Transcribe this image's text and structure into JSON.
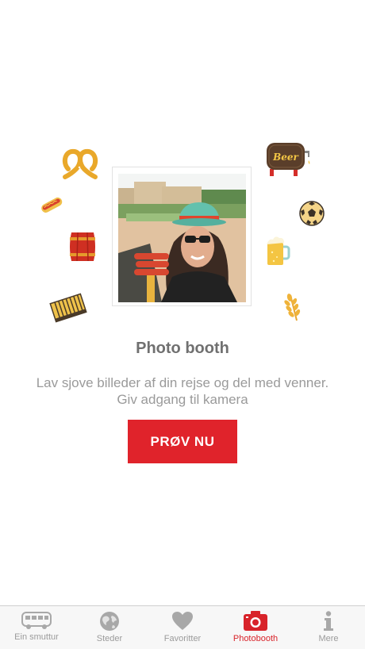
{
  "feature": {
    "title": "Photo booth",
    "description_line1": "Lav sjove billeder af din rejse og del med venner.",
    "description_line2": "Giv adgang til kamera",
    "cta_label": "PRØV NU"
  },
  "stickers": {
    "beer_sign_text": "Beer"
  },
  "tabbar": {
    "active_tab": "Photobooth",
    "tabs": [
      {
        "label": "Ein smuttur",
        "icon": "van-icon"
      },
      {
        "label": "Steder",
        "icon": "globe-icon"
      },
      {
        "label": "Favoritter",
        "icon": "heart-icon"
      },
      {
        "label": "Photobooth",
        "icon": "camera-icon"
      },
      {
        "label": "Mere",
        "icon": "info-icon"
      }
    ]
  },
  "colors": {
    "accent": "#e0232b",
    "title_text": "#707070",
    "body_text": "#9a9a9a",
    "tab_inactive": "#9b9b9b"
  }
}
